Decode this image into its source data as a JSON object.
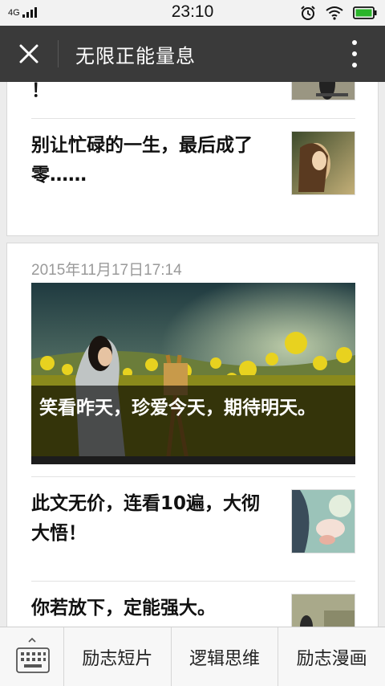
{
  "status_bar": {
    "network": "4G",
    "time": "23:10",
    "icons": [
      "signal-icon",
      "alarm-clock-icon",
      "wifi-icon",
      "battery-icon"
    ]
  },
  "header": {
    "title": "无限正能量息"
  },
  "card1": {
    "partial_text": "！",
    "item": {
      "title": "别让忙碌的一生，最后成了零……"
    }
  },
  "card2": {
    "date": "2015年11月17日17:14",
    "hero": {
      "caption": "笑看昨天，珍爱今天，期待明天。"
    },
    "items": [
      {
        "title": "此文无价，连看10遍，大彻大悟！"
      },
      {
        "title": "你若放下，定能强大。"
      }
    ]
  },
  "bottom_menu": {
    "tabs": [
      {
        "label": "励志短片"
      },
      {
        "label": "逻辑思维"
      },
      {
        "label": "励志漫画"
      }
    ]
  },
  "colors": {
    "title_bar": "#3a3a3a",
    "status_bar": "#f2f2f2",
    "battery": "#2bb52b"
  }
}
